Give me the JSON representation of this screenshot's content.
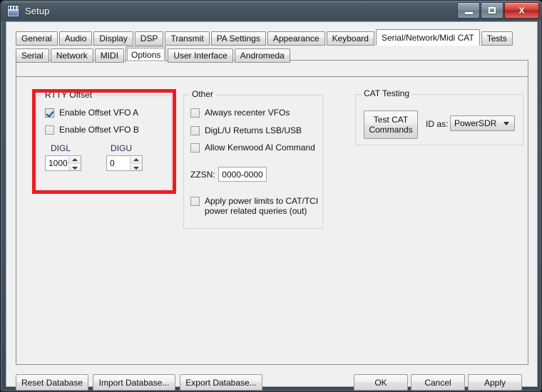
{
  "window": {
    "title": "Setup",
    "icon": "setup-window-icon",
    "controls": {
      "minimize": "minimize-icon",
      "maximize": "maximize-icon",
      "close": "X"
    }
  },
  "tabs_primary": [
    {
      "label": "General",
      "selected": false
    },
    {
      "label": "Audio",
      "selected": false
    },
    {
      "label": "Display",
      "selected": false
    },
    {
      "label": "DSP",
      "selected": false
    },
    {
      "label": "Transmit",
      "selected": false
    },
    {
      "label": "PA Settings",
      "selected": false
    },
    {
      "label": "Appearance",
      "selected": false
    },
    {
      "label": "Keyboard",
      "selected": false
    },
    {
      "label": "Serial/Network/Midi CAT",
      "selected": true
    },
    {
      "label": "Tests",
      "selected": false
    }
  ],
  "tabs_secondary": [
    {
      "label": "Serial",
      "selected": false
    },
    {
      "label": "Network",
      "selected": false
    },
    {
      "label": "MIDI",
      "selected": false
    },
    {
      "label": "Options",
      "selected": true
    },
    {
      "label": "User Interface",
      "selected": false
    },
    {
      "label": "Andromeda",
      "selected": false
    }
  ],
  "rtty_offset": {
    "legend": "RTTY Offset",
    "checkboxes": [
      {
        "label": "Enable Offset VFO A",
        "checked": true
      },
      {
        "label": "Enable Offset VFO B",
        "checked": false
      }
    ],
    "digl": {
      "label": "DIGL",
      "value": "1000"
    },
    "digu": {
      "label": "DIGU",
      "value": "0"
    }
  },
  "other": {
    "legend": "Other",
    "checkboxes": [
      {
        "label": "Always recenter VFOs",
        "checked": false
      },
      {
        "label": "DigL/U Returns LSB/USB",
        "checked": false
      },
      {
        "label": "Allow Kenwood AI Command",
        "checked": false
      }
    ],
    "zzsn": {
      "label": "ZZSN:",
      "value": "0000-0000"
    },
    "power_limits": {
      "label": "Apply power limits to CAT/TCI\npower related queries (out)",
      "checked": false
    }
  },
  "cat_testing": {
    "legend": "CAT Testing",
    "test_button": "Test CAT\nCommands",
    "id_as_label": "ID as:",
    "id_as_value": "PowerSDR",
    "id_as_options": [
      "PowerSDR"
    ]
  },
  "footer": {
    "reset": "Reset Database",
    "import": "Import Database...",
    "export": "Export Database...",
    "ok": "OK",
    "cancel": "Cancel",
    "apply": "Apply"
  },
  "colors": {
    "highlight_rect": "#ed1c24",
    "titlebar": "#44525e",
    "close_button": "#b5231c",
    "field_label": "#2a2a55"
  }
}
